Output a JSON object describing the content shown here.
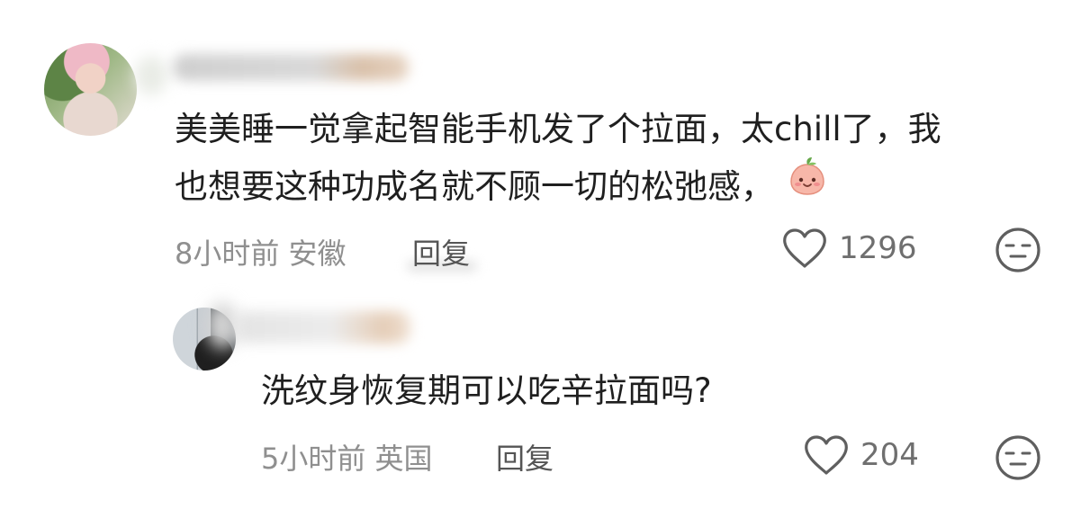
{
  "comments": [
    {
      "text_line1": "美美睡一觉拿起智能手机发了个拉面，太chill了，我",
      "text_line2": "也想要这种功成名就不顾一切的松弛感，",
      "emoji": "peach-face-emoji",
      "time": "8小时前",
      "location": "安徽",
      "reply_label": "回复",
      "likes": "1296"
    },
    {
      "text_line1": "洗纹身恢复期可以吃辛拉面吗?",
      "time": "5小时前",
      "location": "英国",
      "reply_label": "回复",
      "likes": "204"
    }
  ],
  "icons": {
    "like": "heart-outline-icon",
    "dislike": "expressionless-face-icon"
  },
  "colors": {
    "text": "#1f1f1f",
    "meta": "#8f8f8f",
    "icon": "#5f5f5f"
  }
}
